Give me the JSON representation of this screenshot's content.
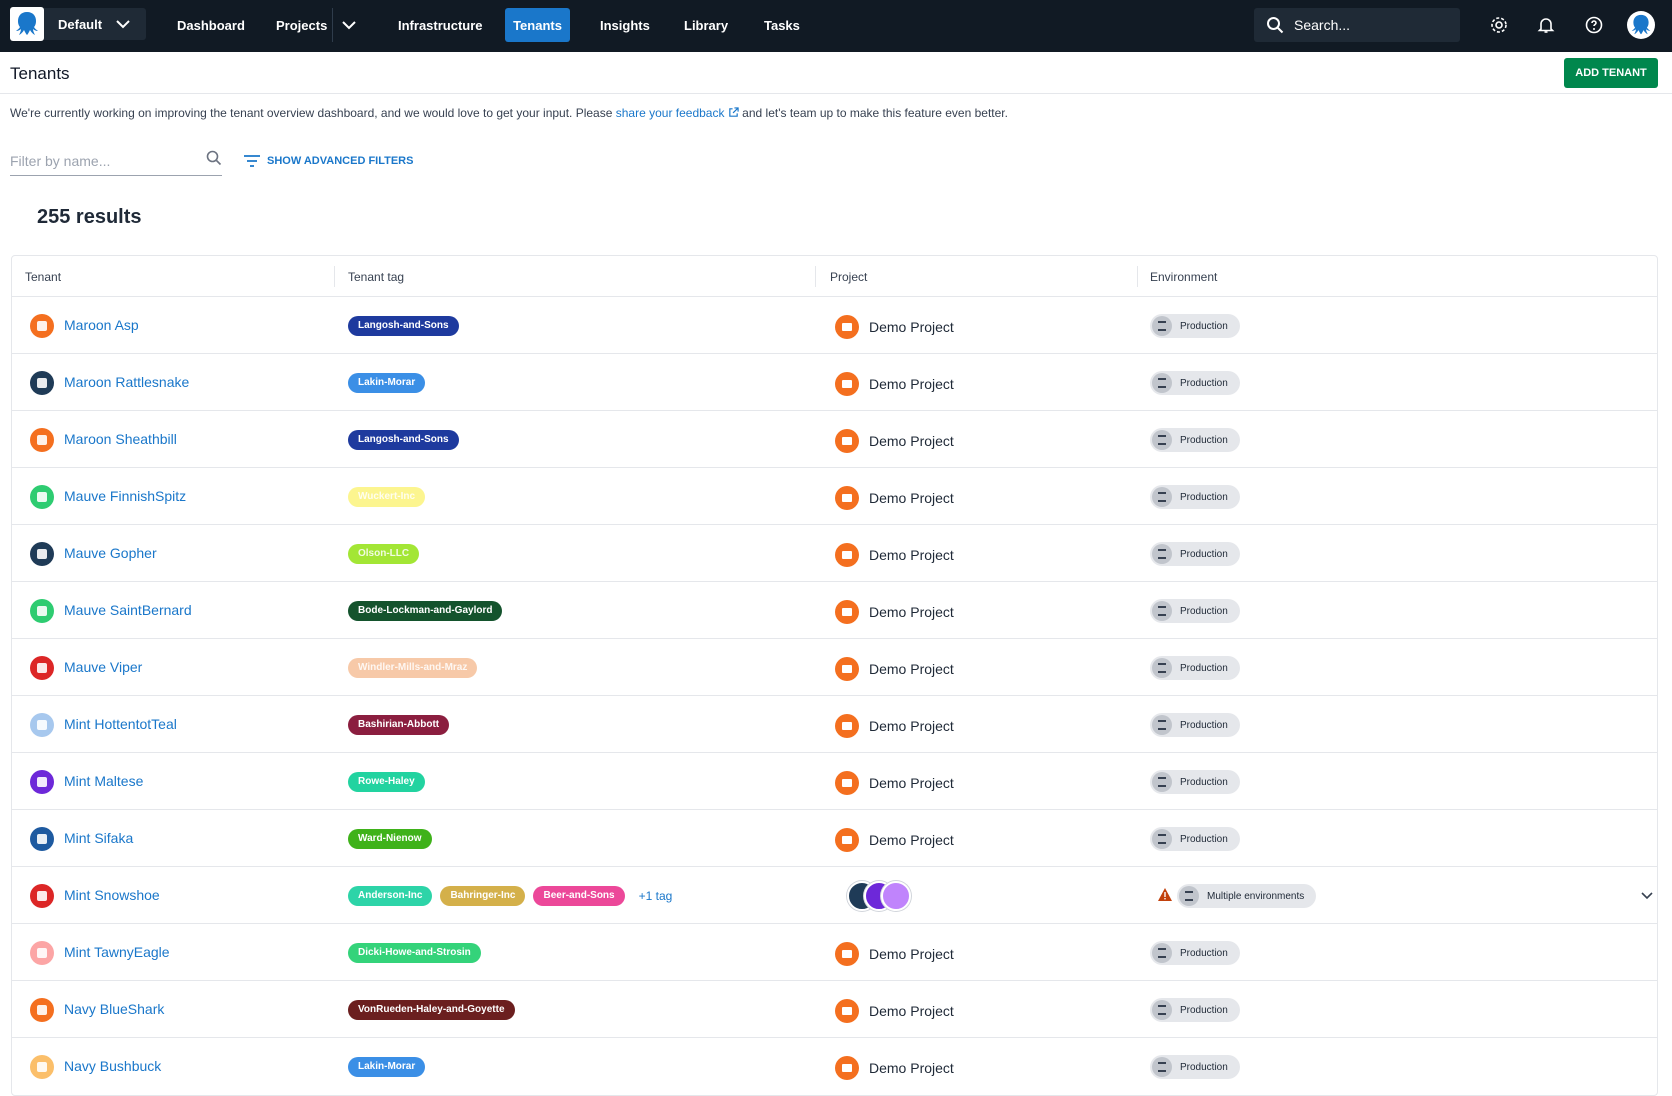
{
  "nav": {
    "space": "Default",
    "items": [
      "Dashboard",
      "Projects",
      "Infrastructure",
      "Tenants",
      "Insights",
      "Library",
      "Tasks"
    ],
    "active": "Tenants",
    "search_placeholder": "Search..."
  },
  "header": {
    "title": "Tenants",
    "add_button": "ADD TENANT"
  },
  "notice": {
    "before": "We're currently working on improving the tenant overview dashboard, and we would love to get your input. Please",
    "link": "share your feedback",
    "after": "and let's team up to make this feature even better."
  },
  "filter": {
    "placeholder": "Filter by name...",
    "advanced": "SHOW ADVANCED FILTERS"
  },
  "results": "255 results",
  "table": {
    "columns": [
      "Tenant",
      "Tenant tag",
      "Project",
      "Environment"
    ],
    "rows": [
      {
        "name": "Maroon Asp",
        "icon_color": "#f46f1f",
        "tags": [
          {
            "label": "Langosh-and-Sons",
            "color": "#1e3a9e"
          }
        ],
        "project": "Demo Project",
        "environment": "Production"
      },
      {
        "name": "Maroon Rattlesnake",
        "icon_color": "#1f3b57",
        "tags": [
          {
            "label": "Lakin-Morar",
            "color": "#3b8fe6"
          }
        ],
        "project": "Demo Project",
        "environment": "Production"
      },
      {
        "name": "Maroon Sheathbill",
        "icon_color": "#f46f1f",
        "tags": [
          {
            "label": "Langosh-and-Sons",
            "color": "#1e3a9e"
          }
        ],
        "project": "Demo Project",
        "environment": "Production"
      },
      {
        "name": "Mauve FinnishSpitz",
        "icon_color": "#2ecc71",
        "tags": [
          {
            "label": "Wuckert-Inc",
            "color": "#fcf58f"
          }
        ],
        "project": "Demo Project",
        "environment": "Production"
      },
      {
        "name": "Mauve Gopher",
        "icon_color": "#1f3b57",
        "tags": [
          {
            "label": "Olson-LLC",
            "color": "#a3e635"
          }
        ],
        "project": "Demo Project",
        "environment": "Production"
      },
      {
        "name": "Mauve SaintBernard",
        "icon_color": "#2ecc71",
        "tags": [
          {
            "label": "Bode-Lockman-and-Gaylord",
            "color": "#14532d"
          }
        ],
        "project": "Demo Project",
        "environment": "Production"
      },
      {
        "name": "Mauve Viper",
        "icon_color": "#dc2626",
        "tags": [
          {
            "label": "Windler-Mills-and-Mraz",
            "color": "#f7c9a8"
          }
        ],
        "project": "Demo Project",
        "environment": "Production"
      },
      {
        "name": "Mint HottentotTeal",
        "icon_color": "#a7c8ee",
        "tags": [
          {
            "label": "Bashirian-Abbott",
            "color": "#8b1e3f"
          }
        ],
        "project": "Demo Project",
        "environment": "Production"
      },
      {
        "name": "Mint Maltese",
        "icon_color": "#6d28d9",
        "tags": [
          {
            "label": "Rowe-Haley",
            "color": "#22d3a0"
          }
        ],
        "project": "Demo Project",
        "environment": "Production"
      },
      {
        "name": "Mint Sifaka",
        "icon_color": "#1e5aa0",
        "tags": [
          {
            "label": "Ward-Nienow",
            "color": "#3fb21a"
          }
        ],
        "project": "Demo Project",
        "environment": "Production"
      },
      {
        "name": "Mint Snowshoe",
        "icon_color": "#dc2626",
        "tags": [
          {
            "label": "Anderson-Inc",
            "color": "#2dd4a8"
          },
          {
            "label": "Bahringer-Inc",
            "color": "#d4b04a"
          },
          {
            "label": "Beer-and-Sons",
            "color": "#ec4899"
          }
        ],
        "more": "+1 tag",
        "project": "",
        "environment": "Multiple environments",
        "multi": true
      },
      {
        "name": "Mint TawnyEagle",
        "icon_color": "#fca5a5",
        "tags": [
          {
            "label": "Dicki-Howe-and-Strosin",
            "color": "#34d37a"
          }
        ],
        "project": "Demo Project",
        "environment": "Production"
      },
      {
        "name": "Navy BlueShark",
        "icon_color": "#f46f1f",
        "tags": [
          {
            "label": "VonRueden-Haley-and-Goyette",
            "color": "#6b1f1f"
          }
        ],
        "project": "Demo Project",
        "environment": "Production"
      },
      {
        "name": "Navy Bushbuck",
        "icon_color": "#fbbf6a",
        "tags": [
          {
            "label": "Lakin-Morar",
            "color": "#3b8fe6"
          }
        ],
        "project": "Demo Project",
        "environment": "Production"
      }
    ]
  }
}
